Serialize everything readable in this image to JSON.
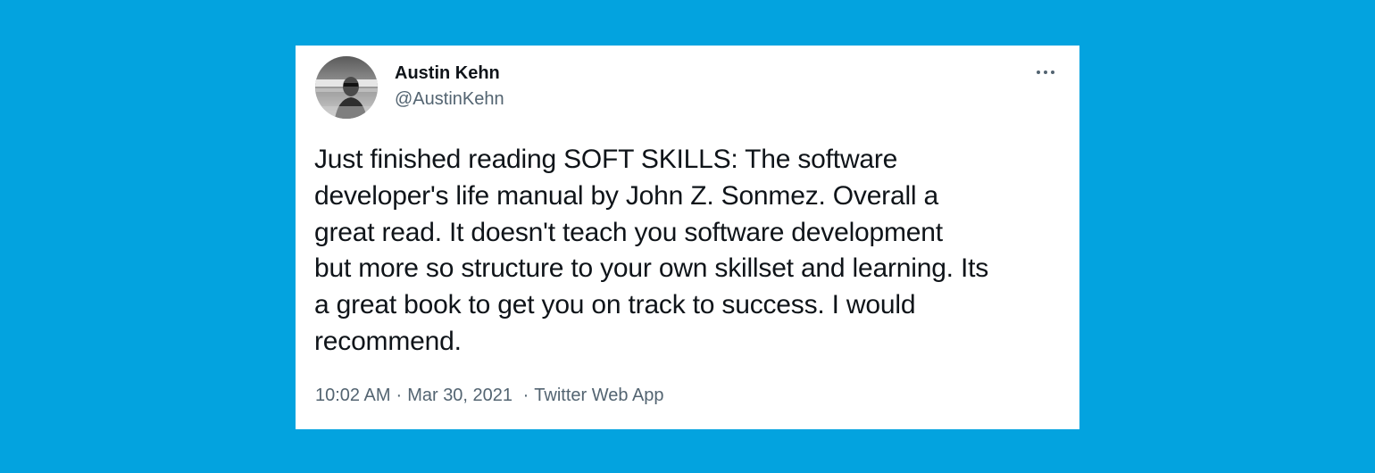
{
  "tweet": {
    "author": {
      "display_name": "Austin Kehn",
      "handle": "@AustinKehn"
    },
    "text_lines": [
      "Just finished reading SOFT SKILLS: The software",
      "developer's life manual by John Z. Sonmez. Overall a",
      "great read. It doesn't teach you software development",
      "but more so structure to your own skillset and learning. Its",
      "a great book to get you on track to success. I would",
      "recommend."
    ],
    "meta": {
      "time": "10:02 AM",
      "separator": "·",
      "date": "Mar 30, 2021",
      "source": "Twitter Web App"
    },
    "icons": {
      "more": "more-horizontal-icon"
    }
  },
  "colors": {
    "background": "#03a3df",
    "card": "#ffffff",
    "text_primary": "#0f1419",
    "text_secondary": "#536471"
  }
}
